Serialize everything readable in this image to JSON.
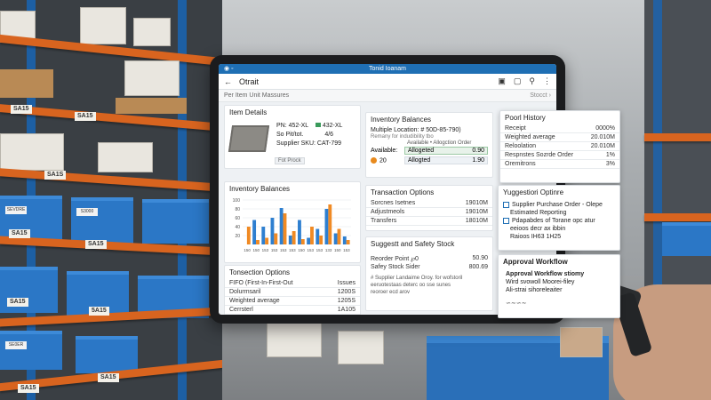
{
  "background": {
    "shelf_tags": [
      "SA15",
      "SA15",
      "SA1S",
      "SA15",
      "SA15",
      "SA15",
      "5A15",
      "SA15",
      "SA15"
    ],
    "bin_labels": [
      "SEVDRE",
      "S3000",
      "SE0ER"
    ]
  },
  "statusbar": {
    "title": "Tonid Ioanam"
  },
  "appbar": {
    "title": "Otrait"
  },
  "subbar": {
    "left": "Per Item Unit Massures",
    "right": "Stocct"
  },
  "item_details": {
    "title": "Item Details",
    "pn": "PN: 452-XL",
    "pn_alt": "432-XL",
    "so": "So Pit/tot.",
    "so_val": "4/6",
    "sku": "Supplier SKU: CAT-799",
    "action": "Fot Prock"
  },
  "inventory_top": {
    "title": "Inventory Balances",
    "multi": "Multiple Location: # 50D-85-790)",
    "multi_sub": "Remany for indudibility tbo",
    "available_label": "Available:",
    "avail_header": "Available • Allogction Order",
    "allocated_label": "Allogeted",
    "allocated_val": "0.90",
    "count": "20",
    "allocated2_label": "Allogted",
    "allocated2_val": "1.90"
  },
  "inventory_chart": {
    "title": "Inventory Balances",
    "ticks": [
      "100",
      "80",
      "60",
      "40",
      "20"
    ]
  },
  "chart_data": {
    "type": "bar",
    "title": "Inventory Balances",
    "categories": [
      "150",
      "150",
      "153",
      "153",
      "153",
      "153",
      "150",
      "153",
      "153",
      "133",
      "150",
      "153"
    ],
    "series": [
      {
        "values": [
          0,
          55,
          40,
          60,
          82,
          20,
          55,
          15,
          35,
          80,
          25,
          18
        ]
      },
      {
        "values": [
          40,
          10,
          15,
          25,
          70,
          30,
          12,
          40,
          20,
          90,
          35,
          10
        ]
      }
    ],
    "colors": [
      "#2e7fd0",
      "#f08a24"
    ],
    "ylim": [
      0,
      100
    ],
    "yticks": [
      100,
      80,
      60,
      40,
      20
    ]
  },
  "transaction_options": {
    "title": "Transaction Options",
    "rows": [
      {
        "label": "Sorcnes Isetnes",
        "value": "19010M"
      },
      {
        "label": "Adjustmeols",
        "value": "19010M"
      },
      {
        "label": "Transfers",
        "value": "18010M"
      }
    ]
  },
  "transaction_bottom": {
    "title": "Tonsection Options",
    "rows": [
      {
        "label": "FIFO (First-In-First-Out",
        "value": "Issues"
      },
      {
        "label": "Dolurmsaril",
        "value": "1200S"
      },
      {
        "label": "Weighted average",
        "value": "1205S"
      },
      {
        "label": "Cerrsterl",
        "value": "1A105"
      }
    ]
  },
  "safety_stock": {
    "title": "Suggestt and Safety Stock",
    "rows": [
      {
        "label": "Reorder Point ℘0",
        "value": "50.90"
      },
      {
        "label": "Safey Stock Sider",
        "value": "800.69"
      }
    ],
    "note1": "# Supplier Landaime Oroy. for wofstoril",
    "note2": "eeruotestaas deterc oo sse sunes",
    "note3": "reoroer ecd arov"
  },
  "period_history": {
    "title": "Poorl History",
    "rows": [
      {
        "label": "Receipt",
        "value": "0000%"
      },
      {
        "label": "Weighted average",
        "value": "20.010M"
      },
      {
        "label": "Reloolation",
        "value": "20.010M"
      },
      {
        "label": "Respnstes Sozrde Order",
        "value": "1%"
      },
      {
        "label": "Oremitrons",
        "value": "3%"
      }
    ]
  },
  "suggestions": {
    "title": "Yuggestiori Optinre",
    "line1": "Supplier Purchase Order - Olepe",
    "line2": "Estimated Reporting",
    "line3": "Pdapabdes of Torane opc atur",
    "line4": "eeioos decr ax ibbin",
    "line5": "Raioos IH63 1H25"
  },
  "approval": {
    "title": "Approval Workflow",
    "heading": "Approval Workflow stiomy",
    "line1": "Wird svowoll Moorei-filey",
    "line2": "Ali-strai sihoreleaiter",
    "button": "ogp lelbon"
  }
}
